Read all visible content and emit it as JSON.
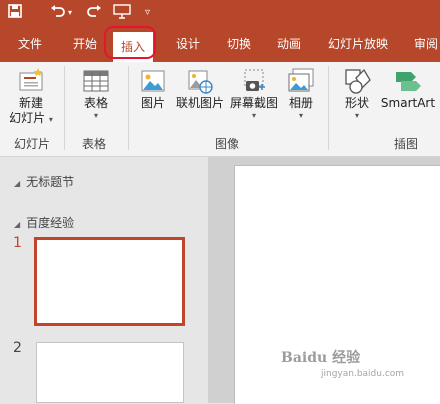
{
  "qat": {
    "icons": [
      "save-icon",
      "undo-icon",
      "redo-icon",
      "present-from-start-icon",
      "customize-qat-icon"
    ]
  },
  "tabs": [
    {
      "label": "文件"
    },
    {
      "label": "开始"
    },
    {
      "label": "插入",
      "active": true
    },
    {
      "label": "设计"
    },
    {
      "label": "切换"
    },
    {
      "label": "动画"
    },
    {
      "label": "幻灯片放映"
    },
    {
      "label": "审阅"
    }
  ],
  "ribbon": {
    "slides": {
      "new_slide_line1": "新建",
      "new_slide_line2": "幻灯片",
      "group_label": "幻灯片"
    },
    "tables": {
      "table": "表格",
      "group_label": "表格"
    },
    "images": {
      "picture": "图片",
      "online_picture": "联机图片",
      "screenshot": "屏幕截图",
      "album": "相册",
      "group_label": "图像"
    },
    "illustrations": {
      "shapes": "形状",
      "smartart": "SmartArt",
      "group_label": "插图"
    }
  },
  "slides_panel": {
    "section1": "无标题节",
    "section2": "百度经验",
    "slides": [
      {
        "number": "1",
        "selected": true
      },
      {
        "number": "2",
        "selected": false
      }
    ]
  },
  "watermark": {
    "text": "Baidu 经验",
    "sub": "jingyan.baidu.com"
  },
  "colors": {
    "accent": "#b7472a",
    "highlight": "#e8132e"
  }
}
